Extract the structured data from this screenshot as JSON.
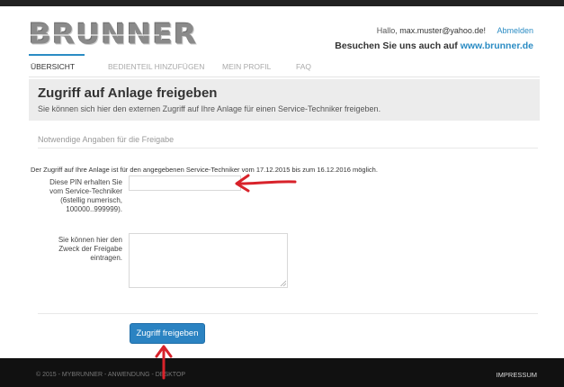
{
  "brand": {
    "logo_text": "BRUNNER"
  },
  "header": {
    "greeting_prefix": "Hallo,",
    "user_email": "max.muster@yahoo.de!",
    "logout_label": "Abmelden",
    "visit_prefix": "Besuchen Sie uns auch auf",
    "visit_link": "www.brunner.de"
  },
  "nav": {
    "items": [
      {
        "label": "ÜBERSICHT"
      },
      {
        "label": "BEDIENTEIL HINZUFÜGEN"
      },
      {
        "label": "MEIN PROFIL"
      },
      {
        "label": "FAQ"
      }
    ],
    "active_index": 0
  },
  "page": {
    "title": "Zugriff auf Anlage freigeben",
    "subtitle": "Sie können sich hier den externen Zugriff auf Ihre Anlage für einen Service-Techniker freigeben.",
    "section_title": "Notwendige Angaben für die Freigabe",
    "info_text": "Der Zugriff auf Ihre Anlage ist für den angegebenen Service-Techniker vom 17.12.2015 bis zum 16.12.2016 möglich."
  },
  "form": {
    "pin_label_lines": [
      "Diese PIN erhalten Sie",
      "vom Service-Techniker",
      "(6stellig numerisch,",
      "100000..999999)."
    ],
    "pin_value": "",
    "zweck_label_lines": [
      "Sie können hier den",
      "Zweck der Freigabe",
      "eintragen."
    ],
    "zweck_value": "",
    "submit_label": "Zugriff freigeben"
  },
  "footer": {
    "left_text": "© 2015 - MYBRUNNER - ANWENDUNG - DESKTOP",
    "right_text": "IMPRESSUM"
  },
  "colors": {
    "accent": "#2b8cc4",
    "button": "#2b83c2",
    "annotation_arrow": "#d8222a",
    "footer_bg": "#111111",
    "hero_bg": "#ececec"
  }
}
